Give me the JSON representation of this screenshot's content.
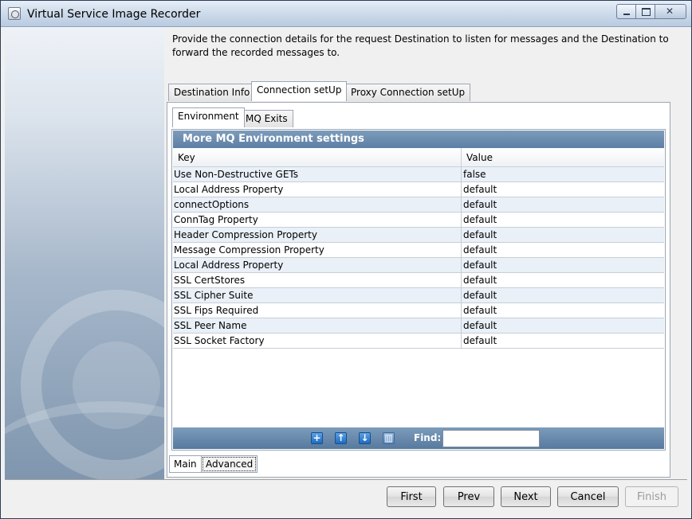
{
  "window": {
    "title": "Virtual Service Image Recorder"
  },
  "instructions": "Provide the connection details for the request Destination to listen for messages and the Destination to forward the recorded messages to.",
  "outer_tabs": {
    "destination_info": "Destination Info",
    "connection_setup": "Connection setUp",
    "proxy_connection_setup": "Proxy Connection setUp",
    "active": "Connection setUp"
  },
  "inner_tabs": {
    "environment": "Environment",
    "mq_exits": "MQ Exits",
    "active": "Environment"
  },
  "panel": {
    "title": "More MQ Environment settings",
    "columns": {
      "key": "Key",
      "value": "Value"
    },
    "rows": [
      {
        "key": "Use Non-Destructive GETs",
        "value": "false"
      },
      {
        "key": "Local Address Property",
        "value": "default"
      },
      {
        "key": "connectOptions",
        "value": "default"
      },
      {
        "key": "ConnTag Property",
        "value": "default"
      },
      {
        "key": "Header Compression Property",
        "value": "default"
      },
      {
        "key": "Message Compression Property",
        "value": "default"
      },
      {
        "key": "Local Address Property",
        "value": "default"
      },
      {
        "key": "SSL CertStores",
        "value": "default"
      },
      {
        "key": "SSL Cipher Suite",
        "value": "default"
      },
      {
        "key": "SSL Fips Required",
        "value": "default"
      },
      {
        "key": "SSL Peer Name",
        "value": "default"
      },
      {
        "key": "SSL Socket Factory",
        "value": "default"
      }
    ],
    "toolbar": {
      "find_label": "Find:",
      "find_value": ""
    }
  },
  "bottom_tabs": {
    "main": "Main",
    "advanced": "Advanced",
    "active": "Main"
  },
  "footer_buttons": {
    "first": "First",
    "prev": "Prev",
    "next": "Next",
    "cancel": "Cancel",
    "finish": "Finish",
    "finish_enabled": false
  },
  "icons": {
    "add": "plus-icon",
    "move_up": "arrow-up-icon",
    "move_down": "arrow-down-icon",
    "delete": "trash-icon"
  },
  "colors": {
    "header_bar": "#6b8cae",
    "row_stripe": "#e9f0f8",
    "titlebar": "#cfdceb"
  }
}
